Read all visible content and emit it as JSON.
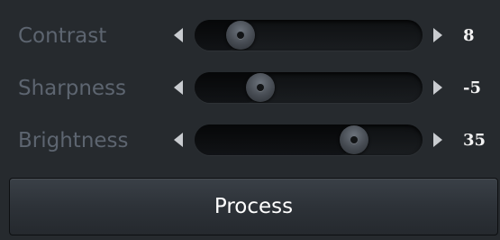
{
  "sliders": [
    {
      "label": "Contrast",
      "value": "8",
      "level": 0.2
    },
    {
      "label": "Sharpness",
      "value": "-5",
      "level": 0.29
    },
    {
      "label": "Brightness",
      "value": "35",
      "level": 0.7
    }
  ],
  "process_button": {
    "label": "Process"
  },
  "icons": {
    "decrease": "caret-left-icon",
    "increase": "caret-right-icon",
    "knob": "slider-knob"
  },
  "colors": {
    "background": "#262a2e",
    "label_text": "#5d6570",
    "value_text": "#f2f2f2",
    "arrow": "#c9ccd0",
    "button_text": "#ffffff"
  }
}
